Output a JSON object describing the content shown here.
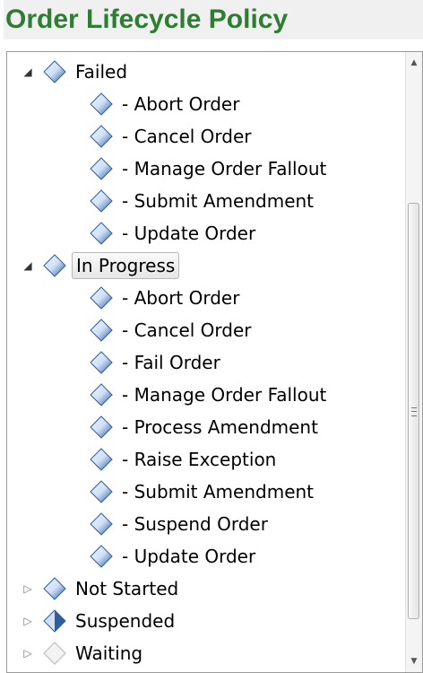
{
  "title": "Order Lifecycle Policy",
  "tree": [
    {
      "label": "Failed",
      "expanded": true,
      "selected": false,
      "icon": "diamond-blue-icon",
      "children": [
        {
          "label": "- Abort Order",
          "icon": "diamond-blue-icon"
        },
        {
          "label": "- Cancel Order",
          "icon": "diamond-blue-icon"
        },
        {
          "label": "- Manage Order Fallout",
          "icon": "diamond-blue-icon"
        },
        {
          "label": "- Submit Amendment",
          "icon": "diamond-blue-icon"
        },
        {
          "label": "- Update Order",
          "icon": "diamond-blue-icon"
        }
      ]
    },
    {
      "label": "In Progress",
      "expanded": true,
      "selected": true,
      "icon": "diamond-blue-icon",
      "children": [
        {
          "label": "- Abort Order",
          "icon": "diamond-blue-icon"
        },
        {
          "label": "- Cancel Order",
          "icon": "diamond-blue-icon"
        },
        {
          "label": "- Fail Order",
          "icon": "diamond-blue-icon"
        },
        {
          "label": "- Manage Order Fallout",
          "icon": "diamond-blue-icon"
        },
        {
          "label": "- Process Amendment",
          "icon": "diamond-blue-icon"
        },
        {
          "label": "- Raise Exception",
          "icon": "diamond-blue-icon"
        },
        {
          "label": "- Submit Amendment",
          "icon": "diamond-blue-icon"
        },
        {
          "label": "- Suspend Order",
          "icon": "diamond-blue-icon"
        },
        {
          "label": "- Update Order",
          "icon": "diamond-blue-icon"
        }
      ]
    },
    {
      "label": "Not Started",
      "expanded": false,
      "selected": false,
      "icon": "diamond-blue-icon",
      "children": []
    },
    {
      "label": "Suspended",
      "expanded": false,
      "selected": false,
      "icon": "diamond-half-blue-icon",
      "children": []
    },
    {
      "label": "Waiting",
      "expanded": false,
      "selected": false,
      "icon": "diamond-gray-icon",
      "children": []
    }
  ],
  "colors": {
    "title": "#2e7d32",
    "diamond_blue_light": "#cfe0f7",
    "diamond_blue_dark": "#2f5d9e",
    "diamond_gray": "#c8c8c8"
  }
}
